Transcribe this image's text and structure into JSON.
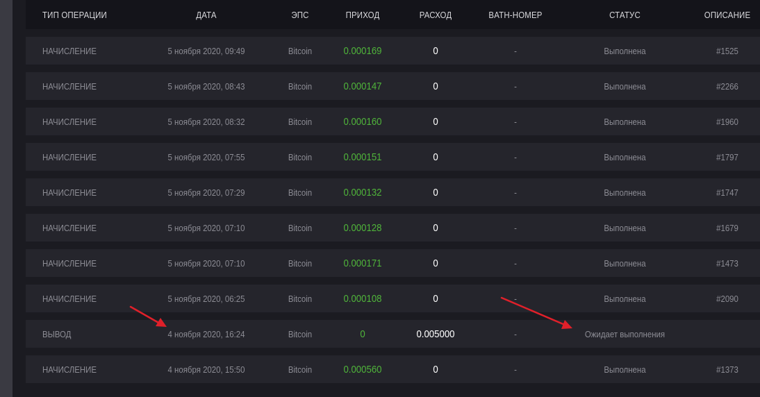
{
  "columns": {
    "type": "ТИП ОПЕРАЦИИ",
    "date": "ДАТА",
    "eps": "ЭПС",
    "income": "ПРИХОД",
    "expense": "РАСХОД",
    "bath": "BATH-НОМЕР",
    "status": "СТАТУС",
    "description": "ОПИСАНИЕ"
  },
  "rows": [
    {
      "type": "НАЧИСЛЕНИЕ",
      "date": "5 ноября 2020, 09:49",
      "eps": "Bitcoin",
      "income": "0.000169",
      "expense": "0",
      "bath": "-",
      "status": "Выполнена",
      "description": "#1525"
    },
    {
      "type": "НАЧИСЛЕНИЕ",
      "date": "5 ноября 2020, 08:43",
      "eps": "Bitcoin",
      "income": "0.000147",
      "expense": "0",
      "bath": "-",
      "status": "Выполнена",
      "description": "#2266"
    },
    {
      "type": "НАЧИСЛЕНИЕ",
      "date": "5 ноября 2020, 08:32",
      "eps": "Bitcoin",
      "income": "0.000160",
      "expense": "0",
      "bath": "-",
      "status": "Выполнена",
      "description": "#1960"
    },
    {
      "type": "НАЧИСЛЕНИЕ",
      "date": "5 ноября 2020, 07:55",
      "eps": "Bitcoin",
      "income": "0.000151",
      "expense": "0",
      "bath": "-",
      "status": "Выполнена",
      "description": "#1797"
    },
    {
      "type": "НАЧИСЛЕНИЕ",
      "date": "5 ноября 2020, 07:29",
      "eps": "Bitcoin",
      "income": "0.000132",
      "expense": "0",
      "bath": "-",
      "status": "Выполнена",
      "description": "#1747"
    },
    {
      "type": "НАЧИСЛЕНИЕ",
      "date": "5 ноября 2020, 07:10",
      "eps": "Bitcoin",
      "income": "0.000128",
      "expense": "0",
      "bath": "-",
      "status": "Выполнена",
      "description": "#1679"
    },
    {
      "type": "НАЧИСЛЕНИЕ",
      "date": "5 ноября 2020, 07:10",
      "eps": "Bitcoin",
      "income": "0.000171",
      "expense": "0",
      "bath": "-",
      "status": "Выполнена",
      "description": "#1473"
    },
    {
      "type": "НАЧИСЛЕНИЕ",
      "date": "5 ноября 2020, 06:25",
      "eps": "Bitcoin",
      "income": "0.000108",
      "expense": "0",
      "bath": "-",
      "status": "Выполнена",
      "description": "#2090"
    },
    {
      "type": "ВЫВОД",
      "date": "4 ноября 2020, 16:24",
      "eps": "Bitcoin",
      "income": "0",
      "expense": "0.005000",
      "bath": "-",
      "status": "Ожидает выполнения",
      "description": ""
    },
    {
      "type": "НАЧИСЛЕНИЕ",
      "date": "4 ноября 2020, 15:50",
      "eps": "Bitcoin",
      "income": "0.000560",
      "expense": "0",
      "bath": "-",
      "status": "Выполнена",
      "description": "#1373"
    }
  ],
  "colors": {
    "income_green": "#4fb33a",
    "annotation_arrow": "#e0202a"
  }
}
